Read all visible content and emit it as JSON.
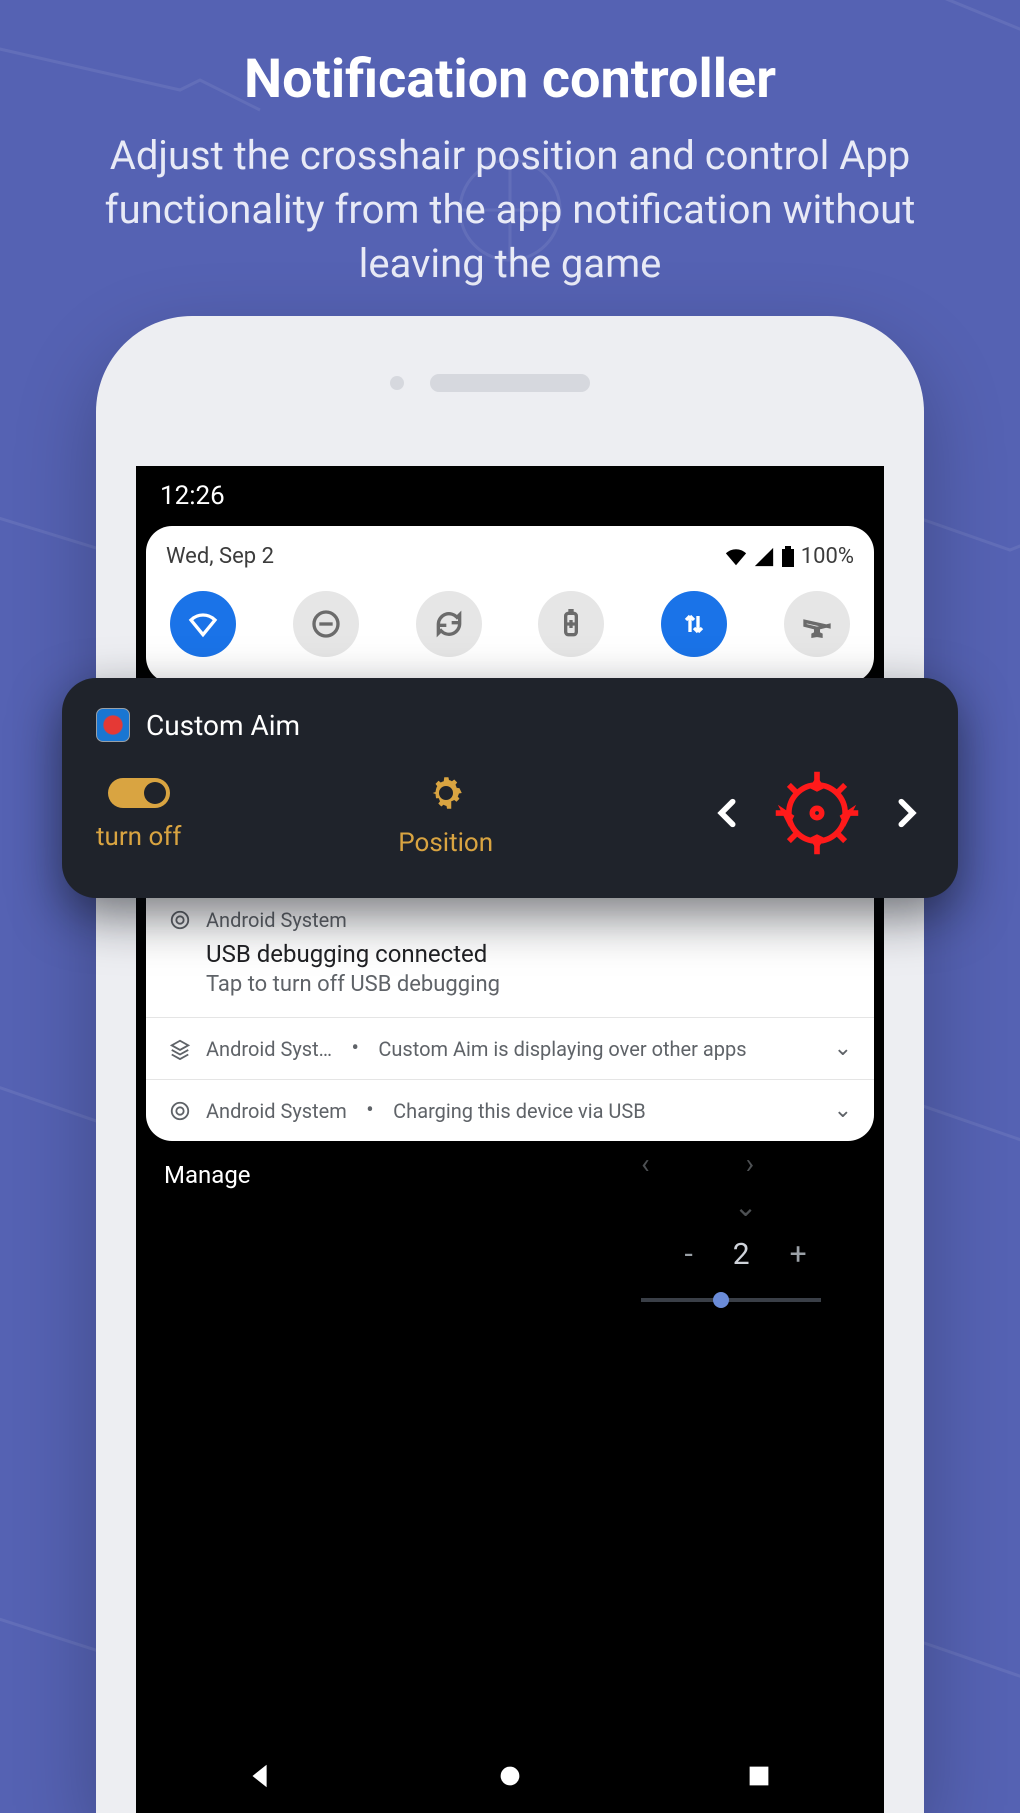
{
  "hero": {
    "title": "Notification controller",
    "subtitle": "Adjust the crosshair position and control App functionality from the app notification without leaving the game"
  },
  "status": {
    "time": "12:26",
    "date": "Wed, Sep 2",
    "battery": "100%"
  },
  "quick_settings": {
    "wifi_active": true,
    "data_active": true
  },
  "notif_card": {
    "app_name": "Custom Aim",
    "turn_off_label": "turn off",
    "position_label": "Position"
  },
  "system_notifs": {
    "row1": {
      "source": "Android System",
      "title": "USB debugging connected",
      "subtitle": "Tap to turn off USB debugging"
    },
    "row2": {
      "source": "Android Syst…",
      "text": "Custom Aim is displaying over other apps"
    },
    "row3": {
      "source": "Android System",
      "text": "Charging this device via USB"
    }
  },
  "below": {
    "manage": "Manage",
    "value": "2",
    "minus": "-",
    "plus": "+"
  }
}
